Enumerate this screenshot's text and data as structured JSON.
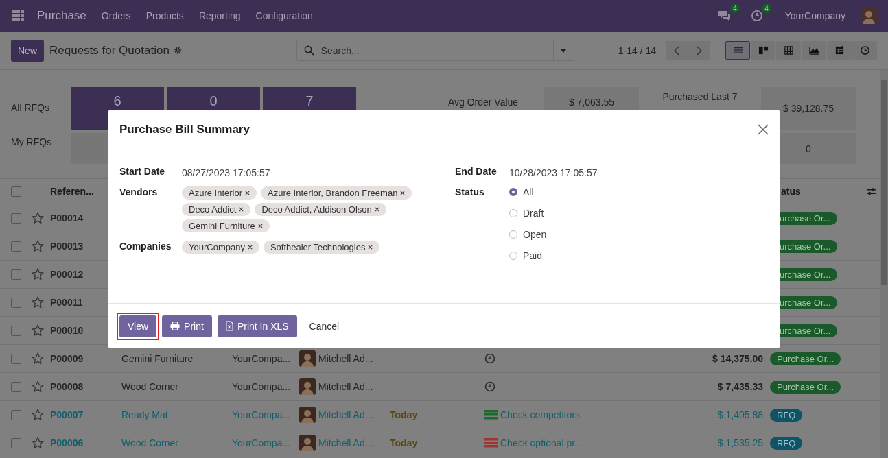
{
  "navbar": {
    "app_name": "Purchase",
    "menu": [
      "Orders",
      "Products",
      "Reporting",
      "Configuration"
    ],
    "messages_count": "4",
    "activities_count": "4",
    "company": "YourCompany"
  },
  "control_panel": {
    "new_button": "New",
    "title": "Requests for Quotation",
    "search_placeholder": "Search...",
    "pager": "1-14 / 14",
    "views": [
      {
        "kind": "list",
        "selected": true
      },
      {
        "kind": "kanban",
        "selected": false
      },
      {
        "kind": "pivot",
        "selected": false
      },
      {
        "kind": "graph",
        "selected": false
      },
      {
        "kind": "calendar",
        "selected": false
      },
      {
        "kind": "activity",
        "selected": false
      }
    ]
  },
  "dashboard": {
    "row_labels": [
      "All RFQs",
      "My RFQs"
    ],
    "tiles": [
      {
        "value": "6"
      },
      {
        "value": "0"
      },
      {
        "value": "7"
      }
    ],
    "avg_label": "Avg Order Value",
    "avg_value": "$ 7,063.55",
    "purchased_label": "Purchased Last 7",
    "purchased_value": "$ 39,128.75",
    "purchased_mine": "0"
  },
  "table": {
    "select_all_checked": false,
    "reference_header": "Referen...",
    "status_header": "atus",
    "rows": [
      {
        "kind": "covered",
        "checked": false,
        "reference": "P00014",
        "status": "urchase Or..."
      },
      {
        "kind": "covered",
        "checked": false,
        "reference": "P00013",
        "status": "urchase Or..."
      },
      {
        "kind": "covered",
        "checked": false,
        "reference": "P00012",
        "status": "urchase Or..."
      },
      {
        "kind": "covered",
        "checked": false,
        "reference": "P00011",
        "status": "urchase Or..."
      },
      {
        "kind": "covered",
        "checked": false,
        "reference": "P00010",
        "status": "urchase Or..."
      },
      {
        "kind": "order",
        "checked": false,
        "reference": "P00009",
        "vendor": "Gemini Furniture",
        "company": "YourCompa...",
        "buyer": "Mitchell Ad...",
        "activity": {
          "kind": "clock"
        },
        "total": "$ 14,375.00",
        "status": "Purchase Or..."
      },
      {
        "kind": "order",
        "checked": false,
        "reference": "P00008",
        "vendor": "Wood Corner",
        "company": "YourCompa...",
        "buyer": "Mitchell Ad...",
        "activity": {
          "kind": "clock"
        },
        "total": "$ 7,435.33",
        "status": "Purchase Or..."
      },
      {
        "kind": "rfq",
        "checked": false,
        "reference": "P00007",
        "vendor": "Ready Mat",
        "company": "YourCompa...",
        "buyer": "Mitchell Ad...",
        "deadline": "Today",
        "activity": {
          "kind": "todo",
          "color": "#1b6b2b",
          "text": "Check competitors"
        },
        "total": "$ 1,405.88",
        "status": "RFQ"
      },
      {
        "kind": "rfq",
        "checked": false,
        "reference": "P00006",
        "vendor": "Wood Corner",
        "company": "YourCompa...",
        "buyer": "Mitchell Ad...",
        "deadline": "Today",
        "activity": {
          "kind": "todo",
          "color": "#a33232",
          "text": "Check optional pr..."
        },
        "total": "$ 1,535.25",
        "status": "RFQ"
      }
    ]
  },
  "modal": {
    "title": "Purchase Bill Summary",
    "start_date": {
      "label": "Start Date",
      "value": "08/27/2023 17:05:57"
    },
    "end_date": {
      "label": "End Date",
      "value": "10/28/2023 17:05:57"
    },
    "vendors": {
      "label": "Vendors",
      "tags": [
        "Azure Interior",
        "Azure Interior, Brandon Freeman",
        "Deco Addict",
        "Deco Addict, Addison Olson",
        "Gemini Furniture"
      ]
    },
    "companies": {
      "label": "Companies",
      "tags": [
        "YourCompany",
        "Softhealer Technologies"
      ]
    },
    "status": {
      "label": "Status",
      "options": [
        {
          "label": "All",
          "selected": true
        },
        {
          "label": "Draft",
          "selected": false
        },
        {
          "label": "Open",
          "selected": false
        },
        {
          "label": "Paid",
          "selected": false
        }
      ]
    },
    "buttons": [
      {
        "kind": "primary",
        "label": "View",
        "focused": true
      },
      {
        "kind": "print",
        "label": "Print",
        "focused": false
      },
      {
        "kind": "xls",
        "label": "Print In XLS",
        "focused": false
      },
      {
        "kind": "link",
        "label": "Cancel",
        "focused": false
      }
    ]
  }
}
